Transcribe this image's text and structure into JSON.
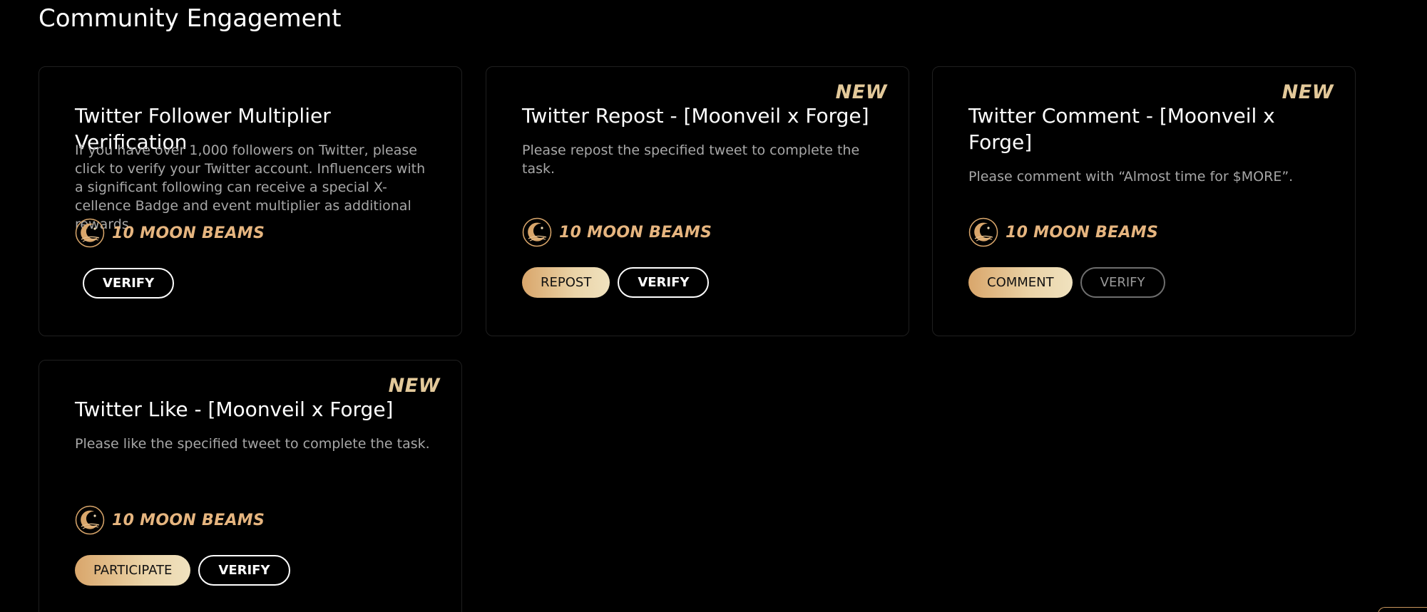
{
  "section": {
    "title": "Community Engagement"
  },
  "colors": {
    "background": "#000000",
    "card_border": "#1f1f1f",
    "accent_gold": "#e6b57f",
    "badge_gold": "#e3c99a",
    "description_gray": "#a7a7a7"
  },
  "cards": [
    {
      "title": "Twitter Follower Multiplier Verification",
      "description": "If you have over 1,000 followers on Twitter, please click to verify your Twitter account. Influencers with a significant following can receive a special X-cellence Badge and event multiplier as additional rewards.",
      "reward": "10 MOON BEAMS",
      "reward_icon": "moon-beam-icon",
      "buttons": [
        {
          "label": "VERIFY",
          "style": "outline"
        }
      ]
    },
    {
      "badge": "NEW",
      "title": "Twitter Repost - [Moonveil x Forge]",
      "description": "Please repost the specified tweet to complete the task.",
      "reward": "10 MOON BEAMS",
      "reward_icon": "moon-beam-icon",
      "buttons": [
        {
          "label": "REPOST",
          "style": "gold"
        },
        {
          "label": "VERIFY",
          "style": "outline"
        }
      ]
    },
    {
      "badge": "NEW",
      "title": "Twitter Comment - [Moonveil x Forge]",
      "description": "Please comment with “Almost time for $MORE”.",
      "reward": "10 MOON BEAMS",
      "reward_icon": "moon-beam-icon",
      "buttons": [
        {
          "label": "COMMENT",
          "style": "gold"
        },
        {
          "label": "VERIFY",
          "style": "outline-dim"
        }
      ]
    },
    {
      "badge": "NEW",
      "title": "Twitter Like - [Moonveil x Forge]",
      "description": "Please like the specified tweet to complete the task.",
      "reward": "10 MOON BEAMS",
      "reward_icon": "moon-beam-icon",
      "buttons": [
        {
          "label": "PARTICIPATE",
          "style": "gold"
        },
        {
          "label": "VERIFY",
          "style": "outline"
        }
      ]
    }
  ]
}
